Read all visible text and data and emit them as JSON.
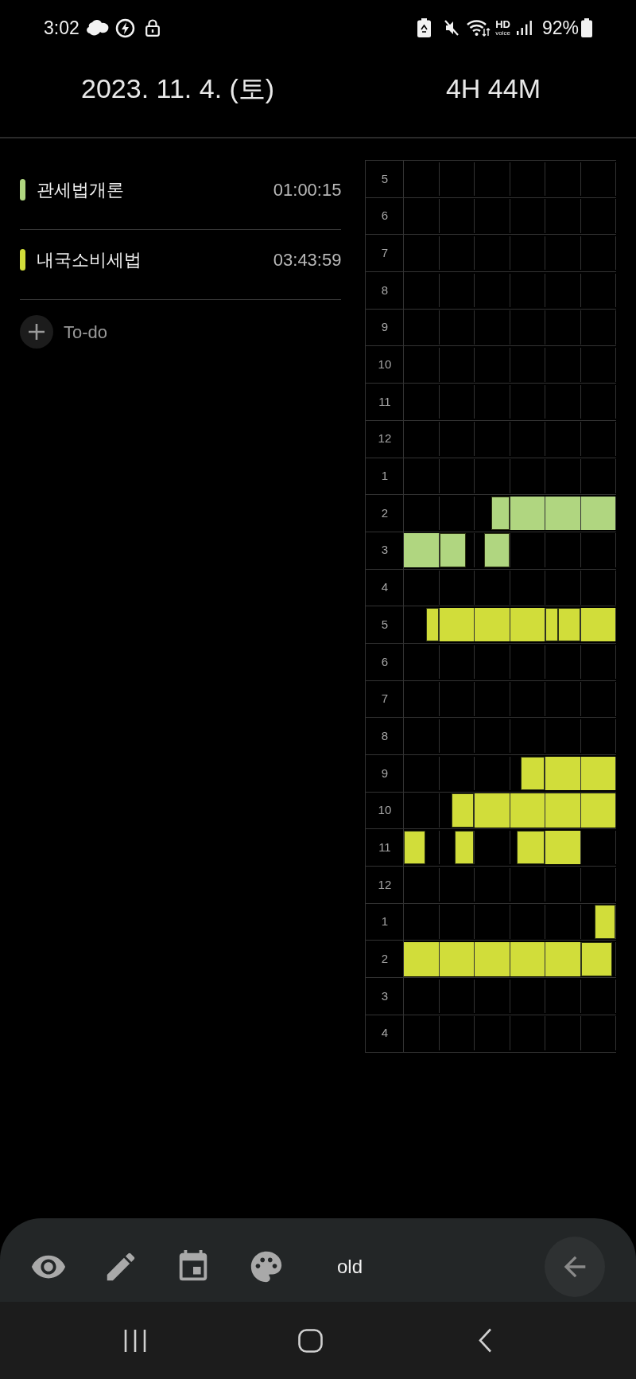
{
  "status_bar": {
    "time": "3:02",
    "hd": "HD",
    "voice": "voice",
    "battery": "92%"
  },
  "header": {
    "date": "2023. 11. 4. (토)",
    "total": "4H 44M"
  },
  "subjects": [
    {
      "name": "관세법개론",
      "time": "01:00:15",
      "color": "#b0d680"
    },
    {
      "name": "내국소비세법",
      "time": "03:43:59",
      "color": "#d1dd3a"
    }
  ],
  "add_todo": {
    "label": "To-do"
  },
  "grid": {
    "rows": [
      {
        "hour": "5",
        "cells": [
          {
            "kind": "empty"
          },
          {
            "kind": "empty"
          },
          {
            "kind": "empty"
          },
          {
            "kind": "empty"
          },
          {
            "kind": "empty"
          },
          {
            "kind": "empty"
          }
        ]
      },
      {
        "hour": "6",
        "cells": [
          {
            "kind": "empty"
          },
          {
            "kind": "empty"
          },
          {
            "kind": "empty"
          },
          {
            "kind": "empty"
          },
          {
            "kind": "empty"
          },
          {
            "kind": "empty"
          }
        ]
      },
      {
        "hour": "7",
        "cells": [
          {
            "kind": "empty"
          },
          {
            "kind": "empty"
          },
          {
            "kind": "empty"
          },
          {
            "kind": "empty"
          },
          {
            "kind": "empty"
          },
          {
            "kind": "empty"
          }
        ]
      },
      {
        "hour": "8",
        "cells": [
          {
            "kind": "empty"
          },
          {
            "kind": "empty"
          },
          {
            "kind": "empty"
          },
          {
            "kind": "empty"
          },
          {
            "kind": "empty"
          },
          {
            "kind": "empty"
          }
        ]
      },
      {
        "hour": "9",
        "cells": [
          {
            "kind": "empty"
          },
          {
            "kind": "empty"
          },
          {
            "kind": "empty"
          },
          {
            "kind": "empty"
          },
          {
            "kind": "empty"
          },
          {
            "kind": "empty"
          }
        ]
      },
      {
        "hour": "10",
        "cells": [
          {
            "kind": "empty"
          },
          {
            "kind": "empty"
          },
          {
            "kind": "empty"
          },
          {
            "kind": "empty"
          },
          {
            "kind": "empty"
          },
          {
            "kind": "empty"
          }
        ]
      },
      {
        "hour": "11",
        "cells": [
          {
            "kind": "empty"
          },
          {
            "kind": "empty"
          },
          {
            "kind": "empty"
          },
          {
            "kind": "empty"
          },
          {
            "kind": "empty"
          },
          {
            "kind": "empty"
          }
        ]
      },
      {
        "hour": "12",
        "cells": [
          {
            "kind": "empty"
          },
          {
            "kind": "empty"
          },
          {
            "kind": "empty"
          },
          {
            "kind": "empty"
          },
          {
            "kind": "empty"
          },
          {
            "kind": "empty"
          }
        ]
      },
      {
        "hour": "1",
        "cells": [
          {
            "kind": "empty"
          },
          {
            "kind": "empty"
          },
          {
            "kind": "empty"
          },
          {
            "kind": "empty"
          },
          {
            "kind": "empty"
          },
          {
            "kind": "empty"
          }
        ]
      },
      {
        "hour": "2",
        "cells": [
          {
            "kind": "empty"
          },
          {
            "kind": "empty"
          },
          {
            "kind": "filled",
            "segments": [
              {
                "kind": "end",
                "level": 0.52,
                "color": "#b0d680"
              }
            ]
          },
          {
            "kind": "filled",
            "segments": [
              {
                "kind": "full",
                "color": "#b0d680"
              }
            ]
          },
          {
            "kind": "filled",
            "segments": [
              {
                "kind": "full",
                "color": "#b0d680"
              }
            ]
          },
          {
            "kind": "filled",
            "segments": [
              {
                "kind": "full",
                "color": "#b0d680"
              }
            ]
          }
        ]
      },
      {
        "hour": "3",
        "cells": [
          {
            "kind": "filled",
            "segments": [
              {
                "kind": "full",
                "color": "#b0d680"
              }
            ]
          },
          {
            "kind": "filled",
            "segments": [
              {
                "kind": "start",
                "level": 0.77,
                "color": "#b0d680"
              }
            ]
          },
          {
            "kind": "filled",
            "segments": [
              {
                "kind": "end",
                "level": 0.73,
                "color": "#b0d680"
              }
            ]
          },
          {
            "kind": "empty"
          },
          {
            "kind": "empty"
          },
          {
            "kind": "empty"
          }
        ]
      },
      {
        "hour": "4",
        "cells": [
          {
            "kind": "empty"
          },
          {
            "kind": "empty"
          },
          {
            "kind": "empty"
          },
          {
            "kind": "empty"
          },
          {
            "kind": "empty"
          },
          {
            "kind": "empty"
          }
        ]
      },
      {
        "hour": "5",
        "cells": [
          {
            "kind": "filled",
            "segments": [
              {
                "kind": "end",
                "level": 0.36,
                "color": "#d1dd3a"
              }
            ]
          },
          {
            "kind": "filled",
            "segments": [
              {
                "kind": "full",
                "color": "#d1dd3a"
              }
            ]
          },
          {
            "kind": "filled",
            "segments": [
              {
                "kind": "full",
                "color": "#d1dd3a"
              }
            ]
          },
          {
            "kind": "filled",
            "segments": [
              {
                "kind": "full",
                "color": "#d1dd3a"
              }
            ]
          },
          {
            "kind": "filled",
            "segments": [
              {
                "kind": "start",
                "level": 0.36,
                "color": "#d1dd3a"
              },
              {
                "kind": "end",
                "level": 0.64,
                "color": "#d1dd3a"
              }
            ]
          },
          {
            "kind": "filled",
            "segments": [
              {
                "kind": "full",
                "color": "#d1dd3a"
              }
            ]
          }
        ]
      },
      {
        "hour": "6",
        "cells": [
          {
            "kind": "empty"
          },
          {
            "kind": "empty"
          },
          {
            "kind": "empty"
          },
          {
            "kind": "empty"
          },
          {
            "kind": "empty"
          },
          {
            "kind": "empty"
          }
        ]
      },
      {
        "hour": "7",
        "cells": [
          {
            "kind": "empty"
          },
          {
            "kind": "empty"
          },
          {
            "kind": "empty"
          },
          {
            "kind": "empty"
          },
          {
            "kind": "empty"
          },
          {
            "kind": "empty"
          }
        ]
      },
      {
        "hour": "8",
        "cells": [
          {
            "kind": "empty"
          },
          {
            "kind": "empty"
          },
          {
            "kind": "empty"
          },
          {
            "kind": "empty"
          },
          {
            "kind": "empty"
          },
          {
            "kind": "empty"
          }
        ]
      },
      {
        "hour": "9",
        "cells": [
          {
            "kind": "empty"
          },
          {
            "kind": "empty"
          },
          {
            "kind": "empty"
          },
          {
            "kind": "filled",
            "segments": [
              {
                "kind": "end",
                "level": 0.7,
                "color": "#d1dd3a"
              }
            ]
          },
          {
            "kind": "filled",
            "segments": [
              {
                "kind": "full",
                "color": "#d1dd3a"
              }
            ]
          },
          {
            "kind": "filled",
            "segments": [
              {
                "kind": "full",
                "color": "#d1dd3a"
              }
            ]
          }
        ]
      },
      {
        "hour": "10",
        "cells": [
          {
            "kind": "empty"
          },
          {
            "kind": "filled",
            "segments": [
              {
                "kind": "end",
                "level": 0.66,
                "color": "#d1dd3a"
              }
            ]
          },
          {
            "kind": "filled",
            "segments": [
              {
                "kind": "full",
                "color": "#d1dd3a"
              }
            ]
          },
          {
            "kind": "filled",
            "segments": [
              {
                "kind": "full",
                "color": "#d1dd3a"
              }
            ]
          },
          {
            "kind": "filled",
            "segments": [
              {
                "kind": "full",
                "color": "#d1dd3a"
              }
            ]
          },
          {
            "kind": "filled",
            "segments": [
              {
                "kind": "full",
                "color": "#d1dd3a"
              }
            ]
          }
        ]
      },
      {
        "hour": "11",
        "cells": [
          {
            "kind": "filled",
            "segments": [
              {
                "kind": "start",
                "level": 0.62,
                "color": "#d1dd3a"
              }
            ]
          },
          {
            "kind": "filled",
            "segments": [
              {
                "kind": "end",
                "level": 0.55,
                "color": "#d1dd3a"
              }
            ]
          },
          {
            "kind": "empty"
          },
          {
            "kind": "filled",
            "segments": [
              {
                "kind": "end",
                "level": 0.82,
                "color": "#d1dd3a"
              }
            ]
          },
          {
            "kind": "filled",
            "segments": [
              {
                "kind": "full",
                "color": "#d1dd3a"
              }
            ]
          },
          {
            "kind": "empty"
          }
        ]
      },
      {
        "hour": "12",
        "cells": [
          {
            "kind": "empty"
          },
          {
            "kind": "empty"
          },
          {
            "kind": "empty"
          },
          {
            "kind": "empty"
          },
          {
            "kind": "empty"
          },
          {
            "kind": "empty"
          }
        ]
      },
      {
        "hour": "1",
        "cells": [
          {
            "kind": "empty"
          },
          {
            "kind": "empty"
          },
          {
            "kind": "empty"
          },
          {
            "kind": "empty"
          },
          {
            "kind": "empty"
          },
          {
            "kind": "filled",
            "segments": [
              {
                "kind": "end",
                "level": 0.59,
                "color": "#d1dd3a"
              }
            ]
          }
        ]
      },
      {
        "hour": "2",
        "cells": [
          {
            "kind": "filled",
            "segments": [
              {
                "kind": "full",
                "color": "#d1dd3a"
              }
            ]
          },
          {
            "kind": "filled",
            "segments": [
              {
                "kind": "full",
                "color": "#d1dd3a"
              }
            ]
          },
          {
            "kind": "filled",
            "segments": [
              {
                "kind": "full",
                "color": "#d1dd3a"
              }
            ]
          },
          {
            "kind": "filled",
            "segments": [
              {
                "kind": "full",
                "color": "#d1dd3a"
              }
            ]
          },
          {
            "kind": "filled",
            "segments": [
              {
                "kind": "full",
                "color": "#d1dd3a"
              }
            ]
          },
          {
            "kind": "filled",
            "segments": [
              {
                "kind": "start",
                "level": 0.9,
                "color": "#d1dd3a"
              }
            ]
          }
        ]
      },
      {
        "hour": "3",
        "cells": [
          {
            "kind": "empty"
          },
          {
            "kind": "empty"
          },
          {
            "kind": "empty"
          },
          {
            "kind": "empty"
          },
          {
            "kind": "empty"
          },
          {
            "kind": "empty"
          }
        ]
      },
      {
        "hour": "4",
        "cells": [
          {
            "kind": "empty"
          },
          {
            "kind": "empty"
          },
          {
            "kind": "empty"
          },
          {
            "kind": "empty"
          },
          {
            "kind": "empty"
          },
          {
            "kind": "empty"
          }
        ]
      }
    ]
  },
  "toolbar": {
    "label": "old"
  }
}
